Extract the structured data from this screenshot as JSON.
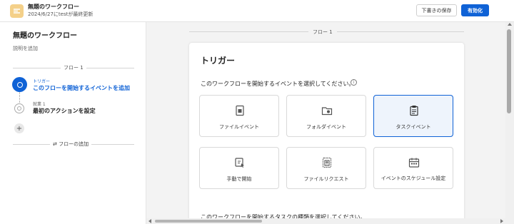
{
  "header": {
    "title": "無題のワークフロー",
    "subtitle": "2024/6/27にtestが最終更新",
    "save_label": "下書きの保存",
    "enable_label": "有効化",
    "icon": "workflow-icon"
  },
  "sidebar": {
    "workflow_name": "無題のワークフロー",
    "description_placeholder": "説明を追加",
    "flow_label": "フロー 1",
    "steps": [
      {
        "small": "トリガー",
        "main": "このフローを開始するイベントを追加"
      },
      {
        "small": "就業 1",
        "main": "最初のアクションを設定"
      }
    ],
    "add_flow_label": "フローの追加"
  },
  "canvas": {
    "flow_label": "フロー 1",
    "panel_title": "トリガー",
    "prompt": "このワークフローを開始するイベントを選択してください。",
    "prompt2": "このワークフローを開始するタスクの種類を選択してください。",
    "cards": [
      {
        "label": "ファイルイベント",
        "icon": "file-event-icon"
      },
      {
        "label": "フォルダイベント",
        "icon": "folder-event-icon"
      },
      {
        "label": "タスクイベント",
        "icon": "task-event-icon"
      },
      {
        "label": "手動で開始",
        "icon": "manual-start-icon"
      },
      {
        "label": "ファイルリクエスト",
        "icon": "file-request-icon"
      },
      {
        "label": "イベントのスケジュール設定",
        "icon": "schedule-icon"
      }
    ]
  },
  "colors": {
    "accent": "#0f62d6",
    "app_icon": "#f4d089",
    "selected_card_bg": "#eef4fc"
  }
}
